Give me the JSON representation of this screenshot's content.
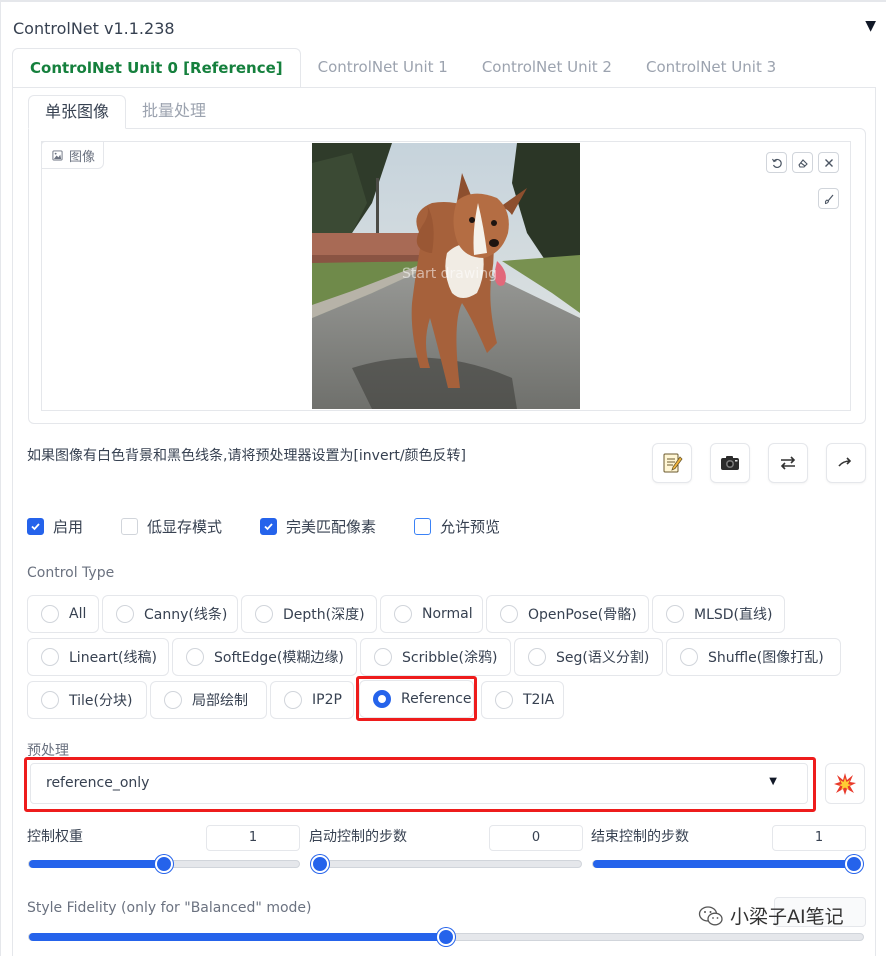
{
  "panel": {
    "title": "ControlNet v1.1.238"
  },
  "unit_tabs": [
    {
      "label": "ControlNet Unit 0 [Reference]",
      "active": true
    },
    {
      "label": "ControlNet Unit 1",
      "active": false
    },
    {
      "label": "ControlNet Unit 2",
      "active": false
    },
    {
      "label": "ControlNet Unit 3",
      "active": false
    }
  ],
  "sub_tabs": [
    {
      "label": "单张图像",
      "active": true
    },
    {
      "label": "批量处理",
      "active": false
    }
  ],
  "image_input": {
    "label": "图像",
    "overlay_text": "Start drawing"
  },
  "invert_note": "如果图像有白色背景和黑色线条,请将预处理器设置为[invert/颜色反转]",
  "checkboxes": [
    {
      "label": "启用",
      "checked": true
    },
    {
      "label": "低显存模式",
      "checked": false
    },
    {
      "label": "完美匹配像素",
      "checked": true
    },
    {
      "label": "允许预览",
      "checked": false
    }
  ],
  "control_type": {
    "label": "Control Type",
    "options": [
      "All",
      "Canny(线条)",
      "Depth(深度)",
      "Normal",
      "OpenPose(骨骼)",
      "MLSD(直线)",
      "Lineart(线稿)",
      "SoftEdge(模糊边缘)",
      "Scribble(涂鸦)",
      "Seg(语义分割)",
      "Shuffle(图像打乱)",
      "Tile(分块)",
      "局部绘制",
      "IP2P",
      "Reference",
      "T2IA"
    ],
    "selected": "Reference"
  },
  "preprocessor": {
    "label": "预处理",
    "value": "reference_only"
  },
  "sliders": {
    "weight": {
      "label": "控制权重",
      "value": "1",
      "fraction": 0.5
    },
    "start": {
      "label": "启动控制的步数",
      "value": "0",
      "fraction": 0
    },
    "end": {
      "label": "结束控制的步数",
      "value": "1",
      "fraction": 1
    },
    "fidelity": {
      "label": "Style Fidelity (only for \"Balanced\" mode)",
      "fraction": 0.5
    }
  },
  "watermark": {
    "text": "小梁子AI笔记"
  },
  "colors": {
    "accent": "#2563eb",
    "active_tab": "#15803d",
    "highlight": "#ee1c1c"
  }
}
